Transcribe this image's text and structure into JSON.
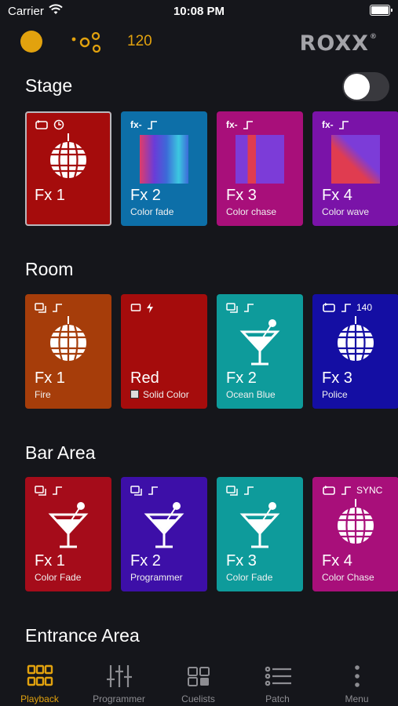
{
  "status_bar": {
    "carrier": "Carrier",
    "time": "10:08 PM"
  },
  "header": {
    "bpm": "120",
    "logo": "ROXX",
    "logo_mark": "®"
  },
  "sections": [
    {
      "title": "Stage",
      "tiles": [
        {
          "title": "Fx 1",
          "sub": "",
          "color": "#a50c0c",
          "selected": true,
          "badges": [
            "loop-icon",
            "timer-icon"
          ],
          "art": "disco-ball-icon"
        },
        {
          "title": "Fx 2",
          "sub": "Color fade",
          "color": "#0d6fa8",
          "badges": [
            "fx-icon",
            "step-icon"
          ],
          "art": "color-fade-gradient"
        },
        {
          "title": "Fx 3",
          "sub": "Color chase",
          "color": "#a80f7a",
          "badges": [
            "fx-icon",
            "step-icon"
          ],
          "art": "color-chase-gradient"
        },
        {
          "title": "Fx 4",
          "sub": "Color wave",
          "color": "#7a13a8",
          "badges": [
            "fx-icon",
            "step-icon"
          ],
          "art": "color-wave-gradient"
        }
      ]
    },
    {
      "title": "Room",
      "tiles": [
        {
          "title": "Fx 1",
          "sub": "Fire",
          "color": "#a63d0a",
          "badges": [
            "scenes-icon",
            "step-icon"
          ],
          "art": "disco-ball-icon"
        },
        {
          "title": "Red",
          "sub": "Solid Color",
          "color": "#a50c0c",
          "badges": [
            "square-icon",
            "flash-icon"
          ],
          "art": ""
        },
        {
          "title": "Fx 2",
          "sub": "Ocean Blue",
          "color": "#0e9b9b",
          "badges": [
            "scenes-icon",
            "step-icon"
          ],
          "art": "cocktail-icon"
        },
        {
          "title": "Fx 3",
          "sub": "Police",
          "color": "#140ea3",
          "badges": [
            "loop-icon",
            "step-icon"
          ],
          "badge_text": "140",
          "art": "disco-ball-icon"
        }
      ]
    },
    {
      "title": "Bar Area",
      "tiles": [
        {
          "title": "Fx 1",
          "sub": "Color Fade",
          "color": "#a50c1a",
          "badges": [
            "scenes-icon",
            "step-icon"
          ],
          "art": "cocktail-icon"
        },
        {
          "title": "Fx 2",
          "sub": "Programmer",
          "color": "#3d0fa8",
          "badges": [
            "scenes-icon",
            "step-icon"
          ],
          "art": "cocktail-icon"
        },
        {
          "title": "Fx 3",
          "sub": "Color Fade",
          "color": "#0e9b9b",
          "badges": [
            "scenes-icon",
            "step-icon"
          ],
          "art": "cocktail-icon"
        },
        {
          "title": "Fx 4",
          "sub": "Color Chase",
          "color": "#a80f7a",
          "badges": [
            "loop-icon",
            "step-icon"
          ],
          "badge_text": "SYNC",
          "art": "disco-ball-icon"
        }
      ]
    },
    {
      "title": "Entrance Area",
      "tiles": []
    }
  ],
  "tabbar": [
    {
      "label": "Playback",
      "icon": "playback-grid-icon",
      "active": true
    },
    {
      "label": "Programmer",
      "icon": "sliders-icon",
      "active": false
    },
    {
      "label": "Cuelists",
      "icon": "cuelists-icon",
      "active": false
    },
    {
      "label": "Patch",
      "icon": "patch-list-icon",
      "active": false
    },
    {
      "label": "Menu",
      "icon": "more-dots-icon",
      "active": false
    }
  ],
  "colors": {
    "accent": "#e2a20e",
    "background": "#15161b",
    "tab_inactive": "#8d8d92",
    "logo": "#a3a3a8"
  }
}
